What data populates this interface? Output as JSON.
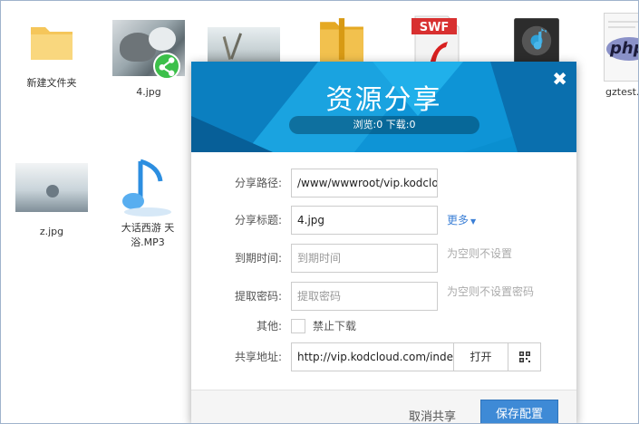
{
  "desktop": {
    "icons": [
      {
        "label": "新建文件夹",
        "icon": "folder-icon"
      },
      {
        "label": "4.jpg",
        "icon": "image-thumbnail"
      },
      {
        "label": "",
        "icon": "image-thumbnail"
      },
      {
        "label": "",
        "icon": "zip-icon"
      },
      {
        "label": "",
        "icon": "swf-icon"
      },
      {
        "label": "",
        "icon": "music-file-icon"
      },
      {
        "label": "gztest.",
        "icon": "php-file-icon"
      },
      {
        "label": "z.jpg",
        "icon": "image-thumbnail"
      },
      {
        "label": "大话西游 天浴.MP3",
        "icon": "music-note-icon"
      }
    ],
    "swf_badge": "SWF",
    "php_badge": "php"
  },
  "dialog": {
    "title": "资源分享",
    "stats": "浏览:0 下载:0",
    "close_glyph": "✖",
    "fields": {
      "path_label": "分享路径:",
      "path_value": "/www/wwwroot/vip.kodcloud.com",
      "title_label": "分享标题:",
      "title_value": "4.jpg",
      "more_label": "更多",
      "expire_label": "到期时间:",
      "expire_placeholder": "到期时间",
      "expire_hint": "为空则不设置",
      "password_label": "提取密码:",
      "password_placeholder": "提取密码",
      "password_hint": "为空则不设置密码",
      "other_label": "其他:",
      "no_download_label": "禁止下载",
      "url_label": "共享地址:",
      "url_value": "http://vip.kodcloud.com/index.php",
      "open_label": "打开"
    },
    "footer": {
      "cancel_label": "取消共享",
      "save_label": "保存配置"
    }
  },
  "colors": {
    "header_blue": "#0a8fd0",
    "button_blue": "#3e8ad6",
    "link_blue": "#3b7fd6"
  }
}
